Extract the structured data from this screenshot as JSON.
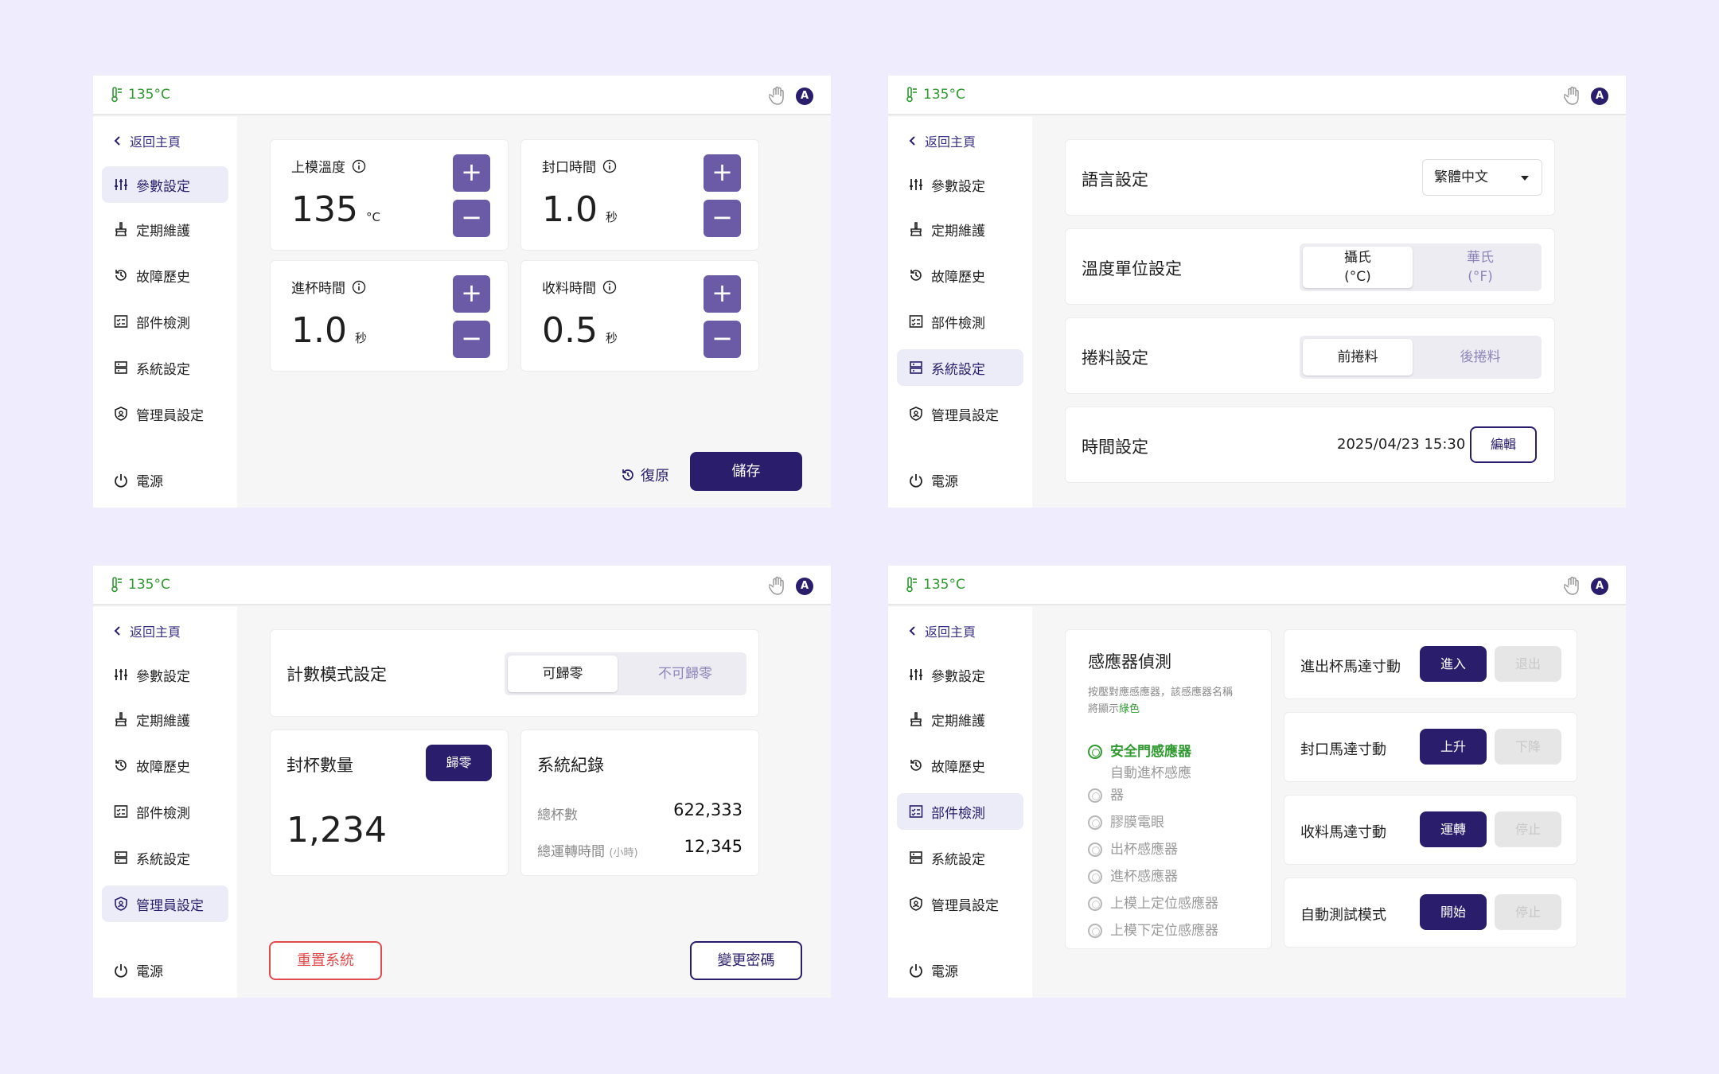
{
  "temperature": "135°C",
  "avatar_letter": "A",
  "nav": {
    "back": "返回主頁",
    "items": [
      "參數設定",
      "定期維護",
      "故障歷史",
      "部件檢測",
      "系統設定",
      "管理員設定"
    ],
    "power": "電源"
  },
  "params": {
    "cards": [
      {
        "label": "上模溫度",
        "value": "135",
        "unit": "°C"
      },
      {
        "label": "封口時間",
        "value": "1.0",
        "unit": "秒"
      },
      {
        "label": "進杯時間",
        "value": "1.0",
        "unit": "秒"
      },
      {
        "label": "收料時間",
        "value": "0.5",
        "unit": "秒"
      }
    ],
    "plus": "+",
    "minus": "−",
    "restore": "復原",
    "save": "儲存"
  },
  "system": {
    "language_label": "語言設定",
    "language_value": "繁體中文",
    "temp_unit_label": "溫度單位設定",
    "celsius": "攝氏",
    "celsius_unit": "(°C)",
    "fahrenheit": "華氏",
    "fahrenheit_unit": "(°F)",
    "roll_label": "捲料設定",
    "roll_front": "前捲料",
    "roll_back": "後捲料",
    "time_label": "時間設定",
    "time_value": "2025/04/23 15:30",
    "edit": "編輯"
  },
  "admin": {
    "count_mode_label": "計數模式設定",
    "resettable": "可歸零",
    "not_resettable": "不可歸零",
    "cup_count_label": "封杯數量",
    "reset_btn": "歸零",
    "cup_count": "1,234",
    "log_title": "系統紀錄",
    "total_cups_label": "總杯數",
    "total_cups": "622,333",
    "runtime_label": "總運轉時間",
    "runtime_unit": "(小時)",
    "runtime": "12,345",
    "reset_system": "重置系統",
    "change_password": "變更密碼"
  },
  "parts": {
    "sensor_title": "感應器偵測",
    "sensor_hint_1": "按壓對應感應器，該感應器名稱",
    "sensor_hint_2": "將顯示",
    "sensor_hint_green": "綠色",
    "sensors": [
      "安全門感應器",
      "自動進杯感應",
      "器",
      "膠膜電眼",
      "出杯感應器",
      "進杯感應器",
      "上模上定位感應器",
      "上模下定位感應器"
    ],
    "motors": [
      {
        "label": "進出杯馬達寸動",
        "on": "進入",
        "off": "退出"
      },
      {
        "label": "封口馬達寸動",
        "on": "上升",
        "off": "下降"
      },
      {
        "label": "收料馬達寸動",
        "on": "運轉",
        "off": "停止"
      },
      {
        "label": "自動測試模式",
        "on": "開始",
        "off": "停止"
      }
    ]
  },
  "colors": {
    "primary": "#2a1d6b",
    "accent_button": "#6b5aa5",
    "green": "#2f9a2f",
    "danger": "#e24b4b",
    "background": "#efedfd"
  }
}
